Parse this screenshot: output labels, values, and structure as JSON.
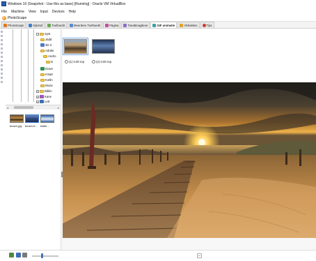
{
  "vm": {
    "title": "Windows 10 (Snapshot - Use this as base) [Running] - Oracle VM VirtualBox",
    "menu": [
      "File",
      "Machine",
      "View",
      "Input",
      "Devices",
      "Help"
    ]
  },
  "app": {
    "title": "PhotoScape"
  },
  "tabs": [
    {
      "label": "PhotoScape",
      "icon": "photoscape-icon",
      "color": "#e07a22"
    },
    {
      "label": "Kijkstuf",
      "icon": "viewer-icon",
      "color": "#3f7fd0"
    },
    {
      "label": "Toeftoedit",
      "icon": "editor-icon",
      "color": "#6aa84f"
    },
    {
      "label": "Meerdere Toeftoedit",
      "icon": "batch-editor-icon",
      "color": "#5b8bd1"
    },
    {
      "label": "Pagina",
      "icon": "page-icon",
      "color": "#c44f9b"
    },
    {
      "label": "Toeabtouglieve",
      "icon": "combine-icon",
      "color": "#8a6fc9"
    },
    {
      "label": "GIF animatie",
      "icon": "gif-icon",
      "color": "#3fa0a0"
    },
    {
      "label": "Afdrukken",
      "icon": "print-icon",
      "color": "#e2a32a"
    },
    {
      "label": "Tips",
      "icon": "help-icon",
      "color": "#d33a2c"
    }
  ],
  "tree": {
    "items": [
      {
        "label": "Syst"
      },
      {
        "label": "Jadd"
      },
      {
        "label": "3D Ir"
      },
      {
        "label": "Adobe"
      },
      {
        "label": "Andro"
      },
      {
        "label": "D"
      },
      {
        "label": "Down"
      },
      {
        "label": "Insad"
      },
      {
        "label": "Kotlin"
      },
      {
        "label": "Moza"
      },
      {
        "label": "Biblio"
      },
      {
        "label": "Kane"
      },
      {
        "label": "Lett"
      }
    ]
  },
  "thumbnails": [
    {
      "label": "beach.jpg"
    },
    {
      "label": "beach-fr..."
    },
    {
      "label": "bsitle..."
    }
  ],
  "main_thumbs": [
    {
      "size_label": "(1) 0.00 mp"
    },
    {
      "size_label": "(2) 0.00 mp"
    }
  ],
  "colors": {
    "accent": "#2a5db0",
    "tab_active_bg": "#ffffff",
    "slider": "#4a6fb5"
  }
}
